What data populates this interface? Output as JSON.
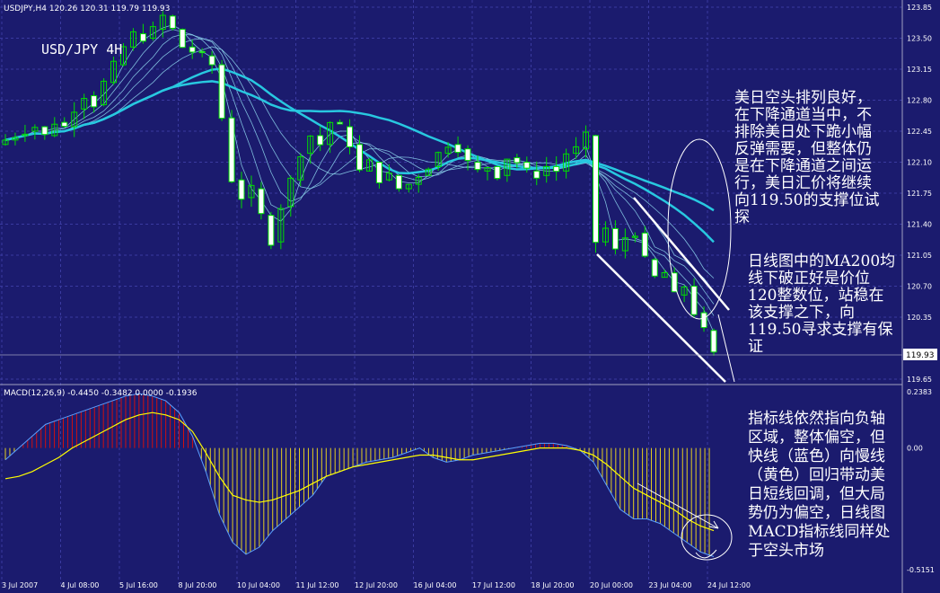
{
  "header": {
    "symbol_info": "USDJPY,H4  120.26 120.31 119.79 119.93",
    "chart_title": "USD/JPY 4H",
    "price_label": "119.93"
  },
  "macd_header": "MACD(12,26,9) -0.4450 -0.3482 0.0000 -0.1936",
  "annotations": {
    "a1": "美日空头排列良好，\n在下降通道当中，不\n排除美日处下跪小幅\n反弹需要，但整体仍\n是在下降通道之间运\n行，美日汇价将继续\n向119.50的支撑位试\n探",
    "a2": "日线图中的MA200均\n线下破正好是价位\n120整数位，站稳在\n该支撑之下，向\n119.50寻求支撑有保\n证",
    "a3": "指标线依然指向负轴\n区域，整体偏空，但\n快线（蓝色）向慢线\n（黄色）回归带动美\n日短线回调，但大局\n势仍为偏空，日线图\nMACD指标线同样处\n于空头市场"
  },
  "colors": {
    "background": "#1b1b6e",
    "grid": "#3a3aa0",
    "bull": "#00dd00",
    "bear": "#ffffff",
    "ma_long": "#28c8e0",
    "ma_short": "#8fd8f0",
    "hist_pos": "#d01010",
    "hist_neg": "#e6d020",
    "macd_fast": "#5aa0ff",
    "macd_slow": "#ffff00",
    "channel": "#ffffff"
  },
  "chart_data": {
    "type": "candlestick",
    "price_axis": {
      "min": 119.65,
      "max": 123.85,
      "ticks": [
        "123.85",
        "123.50",
        "123.15",
        "122.80",
        "122.45",
        "122.10",
        "121.75",
        "121.40",
        "121.05",
        "120.70",
        "120.35",
        "119.65"
      ]
    },
    "macd_axis": {
      "ticks": [
        "0.2383",
        "0.00",
        "-0.5151"
      ],
      "min": -0.5151,
      "max": 0.2383
    },
    "x_labels": [
      "3 Jul 2007",
      "4 Jul 08:00",
      "5 Jul 16:00",
      "8 Jul 20:00",
      "10 Jul 04:00",
      "11 Jul 12:00",
      "12 Jul 20:00",
      "16 Jul 04:00",
      "17 Jul 12:00",
      "18 Jul 20:00",
      "20 Jul 00:00",
      "23 Jul 04:00",
      "24 Jul 12:00"
    ],
    "price_path": [
      122.35,
      122.4,
      122.45,
      122.5,
      122.4,
      122.55,
      122.5,
      122.7,
      122.85,
      122.75,
      123.0,
      123.2,
      123.4,
      123.55,
      123.5,
      123.6,
      123.75,
      123.6,
      123.4,
      123.35,
      123.3,
      123.2,
      122.6,
      121.9,
      121.7,
      121.8,
      121.5,
      121.2,
      121.6,
      121.9,
      122.2,
      122.4,
      122.3,
      122.55,
      122.5,
      122.3,
      122.0,
      122.1,
      121.9,
      121.95,
      121.8,
      121.85,
      121.95,
      122.05,
      122.2,
      122.3,
      122.25,
      122.1,
      122.0,
      122.05,
      121.95,
      122.15,
      122.1,
      122.0,
      121.95,
      122.05,
      122.0,
      122.2,
      122.25,
      122.4,
      121.2,
      121.35,
      121.1,
      121.25,
      121.3,
      121.0,
      120.8,
      120.85,
      120.6,
      120.7,
      120.4,
      120.2,
      119.93
    ],
    "macd_fast": [
      -0.05,
      0.0,
      0.05,
      0.1,
      0.12,
      0.14,
      0.16,
      0.18,
      0.2,
      0.22,
      0.23,
      0.22,
      0.2,
      0.15,
      0.05,
      -0.1,
      -0.28,
      -0.4,
      -0.45,
      -0.42,
      -0.35,
      -0.3,
      -0.25,
      -0.2,
      -0.12,
      -0.1,
      -0.08,
      -0.06,
      -0.05,
      -0.04,
      -0.02,
      0.0,
      -0.04,
      -0.06,
      -0.05,
      -0.03,
      -0.02,
      -0.01,
      0.0,
      0.01,
      0.02,
      0.02,
      0.01,
      -0.01,
      -0.06,
      -0.16,
      -0.26,
      -0.3,
      -0.3,
      -0.32,
      -0.36,
      -0.4,
      -0.44,
      -0.46
    ],
    "macd_slow": [
      -0.13,
      -0.12,
      -0.1,
      -0.07,
      -0.04,
      0.0,
      0.03,
      0.06,
      0.09,
      0.12,
      0.14,
      0.15,
      0.14,
      0.12,
      0.07,
      -0.02,
      -0.12,
      -0.2,
      -0.22,
      -0.23,
      -0.22,
      -0.2,
      -0.18,
      -0.15,
      -0.12,
      -0.1,
      -0.08,
      -0.07,
      -0.06,
      -0.05,
      -0.04,
      -0.03,
      -0.03,
      -0.04,
      -0.05,
      -0.05,
      -0.04,
      -0.03,
      -0.02,
      -0.01,
      0.0,
      0.0,
      0.0,
      -0.01,
      -0.03,
      -0.07,
      -0.12,
      -0.17,
      -0.2,
      -0.23,
      -0.26,
      -0.3,
      -0.33,
      -0.35
    ]
  }
}
